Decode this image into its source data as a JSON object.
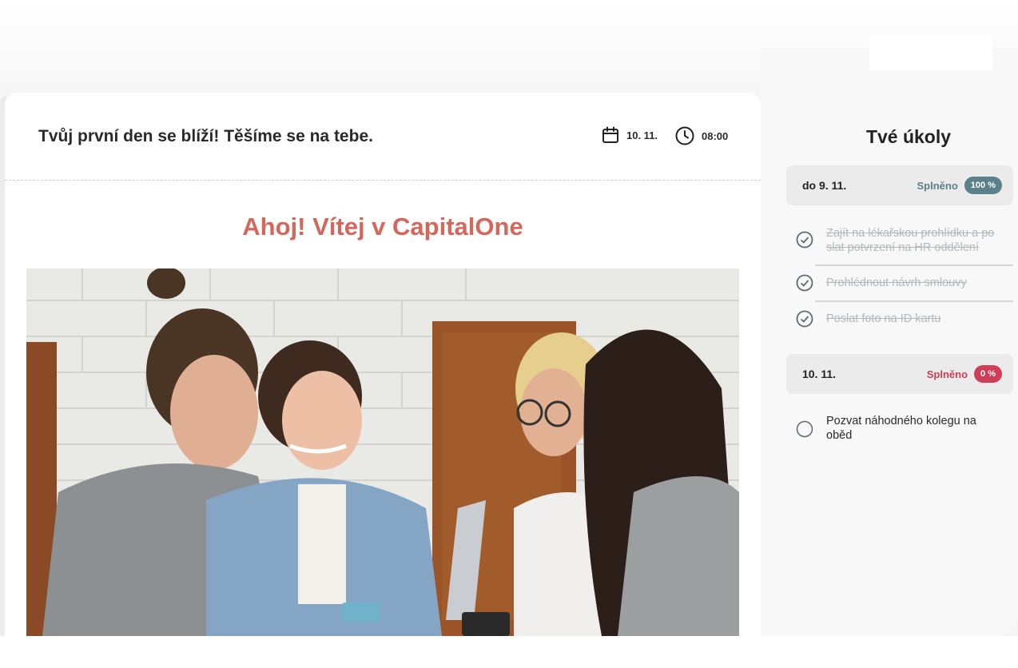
{
  "main": {
    "header_title": "Tvůj první den se blíží! Těšíme se na tebe.",
    "date": "10. 11.",
    "time": "08:00",
    "welcome": "Ahoj! Vítej v CapitalOne",
    "photo_alt": "four colleagues smiling around a table"
  },
  "sidebar": {
    "title": "Tvé úkoly",
    "groups": [
      {
        "date": "do 9. 11.",
        "status_label": "Splněno",
        "badge": "100 %",
        "status_color": "#5a8089",
        "tasks": [
          {
            "label": "Zajít na lékařskou prohlídku a po slat potvrzení na HR oddělení",
            "done": true
          },
          {
            "label": "Prohlédnout návrh smlouvy",
            "done": true
          },
          {
            "label": "Poslat foto na ID kartu",
            "done": true
          }
        ]
      },
      {
        "date": "10. 11.",
        "status_label": "Splněno",
        "badge": "0 %",
        "status_color": "#cf3e56",
        "tasks": [
          {
            "label": "Pozvat náhodného kolegu na oběd",
            "done": false
          }
        ]
      }
    ]
  },
  "icons": {
    "date": "calendar-icon",
    "time": "clock-icon",
    "done": "check-circle-icon",
    "open": "empty-circle-icon"
  }
}
